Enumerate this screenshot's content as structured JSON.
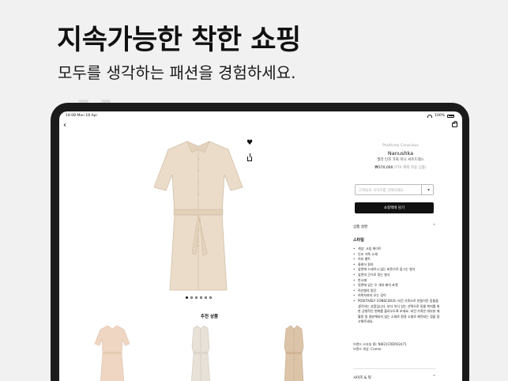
{
  "hero": {
    "title": "지속가능한 착한 쇼핑",
    "subtitle": "모두를 생각하는 패션을 경험하세요."
  },
  "status_bar": {
    "time": "14:08",
    "date": "Mon 18 Apr",
    "battery": "100%"
  },
  "product": {
    "tag": "Positively Conscious",
    "brand": "Nanushka",
    "name": "필라 인조 가죽 미니 셔츠드레스",
    "price": "₩370,000",
    "price_note": "(FTA 혜택 적용 상품)",
    "size_placeholder": "고객님의 사이즈를 선택하세요",
    "buy_label": "쇼핑백에 담기"
  },
  "gallery": {
    "dots": 6,
    "active_dot": 0
  },
  "recommended": {
    "title": "추천 상품"
  },
  "details": {
    "section_label": "상품 설명",
    "style_title": "스타일",
    "style_items": [
      "색상: 크림 화이트",
      "인조 가죽 소재",
      "허리 벨트",
      "클래식 칼라",
      "앞면에 드레이시 않는 버튼으로 잠그는 형식",
      "앞면의 곤으로 묶는 형식",
      "반소매",
      "뒷면에 있는 두 개의 배치 포켓",
      "직선형의 밑단",
      "허벅지까지 오는 길이",
      "POSITIVELY CONSCIOUS: 비건 가죽으로 만들어진 동물을 생각하는 상품입니다. 보다 의식 있는 선택으로 동물 복지를 위한 균형적인 변화를 불러오도록 보세요. 비건 가죽은 대부분 재활용 및 생분해되지 않는 소재로 환경 소재로 제작되는 점을 참고해주세요."
    ],
    "style_code": "브랜드 스타일 ID: NW21CRDR02471",
    "color": "브랜드 색상: Creme",
    "size_section_label": "사이즈 & 핏"
  },
  "colors": {
    "dress": "#ebdcc9",
    "dress_shadow": "#d7c5ae",
    "rec1": "#efd6c2",
    "rec2": "#e7e1d8",
    "rec3": "#dcc4a8"
  }
}
